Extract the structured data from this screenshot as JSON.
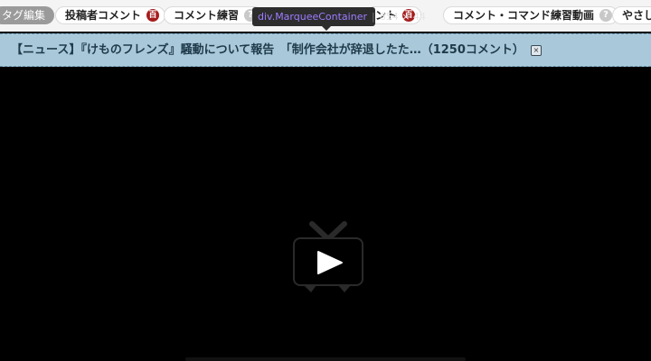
{
  "tagbar": {
    "edit_label": "タグ編集",
    "tags": [
      {
        "label": "投稿者コメント",
        "badge": "百",
        "badge_type": "red"
      },
      {
        "label": "コメント練習",
        "badge": "?",
        "badge_type": "gray"
      },
      {
        "label": "ント",
        "badge": "百",
        "badge_type": "red"
      },
      {
        "label": "コメント・コマンド練習動画",
        "badge": "?",
        "badge_type": "gray"
      },
      {
        "label": "やさし",
        "badge": "",
        "badge_type": "none"
      }
    ]
  },
  "tooltip": {
    "element": "div.MarqueeContainer",
    "size": "854 × 44"
  },
  "marquee": {
    "text": "【ニュース】『けものフレンズ』騒動について報告　「制作会社が辞退したた…（1250コメント）",
    "close_glyph": "×"
  },
  "player": {
    "icon": "tv-play-icon"
  },
  "colors": {
    "marquee_bg": "#a9c9da",
    "badge_red": "#a61d1d",
    "tooltip_class": "#9d7cff"
  }
}
